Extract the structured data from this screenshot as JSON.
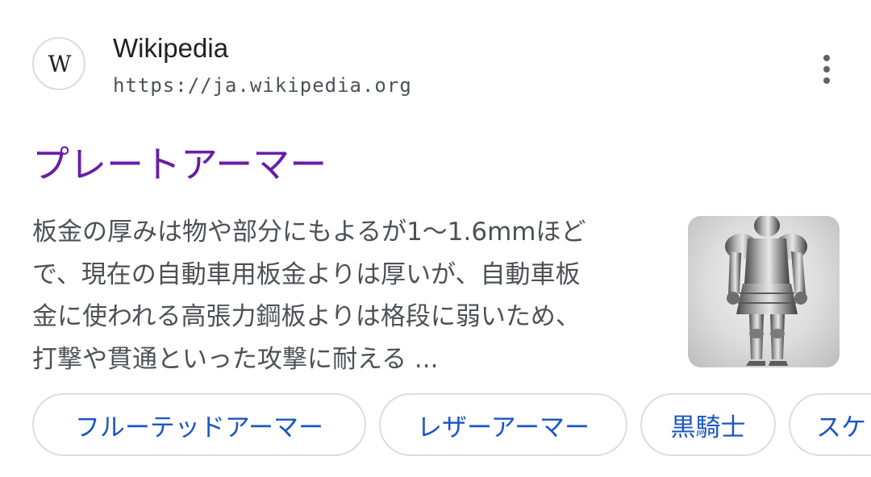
{
  "source": {
    "favicon_letter": "W",
    "site_name": "Wikipedia",
    "url": "https://ja.wikipedia.org",
    "more_icon": "more-vert-icon"
  },
  "result": {
    "title": "プレートアーマー",
    "snippet_lines": [
      "板金の厚みは物や部分にもよるが1〜1.6mmほど",
      "で、現在の自動車用板金よりは厚いが、自動車板",
      "金に使われる高張力鋼板よりは格段に弱いため、",
      "打撃や貫通といった攻撃に耐える ..."
    ],
    "thumbnail": "plate-armor-photo"
  },
  "related_chips": [
    {
      "label": "フルーテッドアーマー"
    },
    {
      "label": "レザーアーマー"
    },
    {
      "label": "黒騎士"
    },
    {
      "label": "スケ"
    }
  ],
  "colors": {
    "title_visited": "#681da8",
    "chip_text": "#1a56c4",
    "snippet_text": "#4d5156",
    "border": "#dadce0"
  }
}
